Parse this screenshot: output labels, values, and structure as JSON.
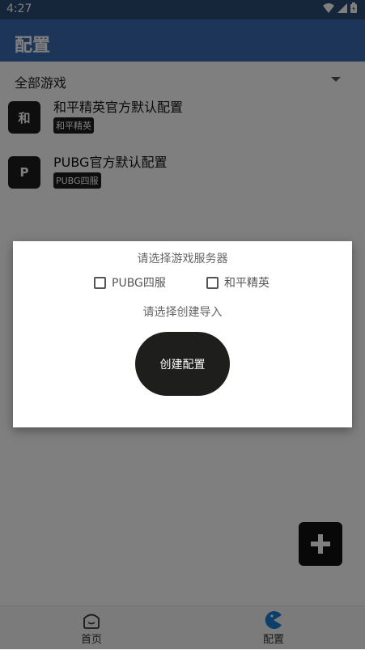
{
  "status": {
    "time": "4:27"
  },
  "app": {
    "title": "配置"
  },
  "filter": {
    "label": "全部游戏"
  },
  "configs": [
    {
      "icon_text": "和",
      "title": "和平精英官方默认配置",
      "tag": "和平精英"
    },
    {
      "icon_text": "P",
      "title": "PUBG官方默认配置",
      "tag": "PUBG四服"
    }
  ],
  "nav": {
    "home": "首页",
    "config": "配置"
  },
  "dialog": {
    "title": "请选择游戏服务器",
    "options": [
      "PUBG四服",
      "和平精英"
    ],
    "subtitle": "请选择创建导入",
    "create_button": "创建配置"
  },
  "colors": {
    "app_bar": "#3b6bb0",
    "status_bar": "#2b4a75",
    "accent": "#1d7fd6"
  }
}
